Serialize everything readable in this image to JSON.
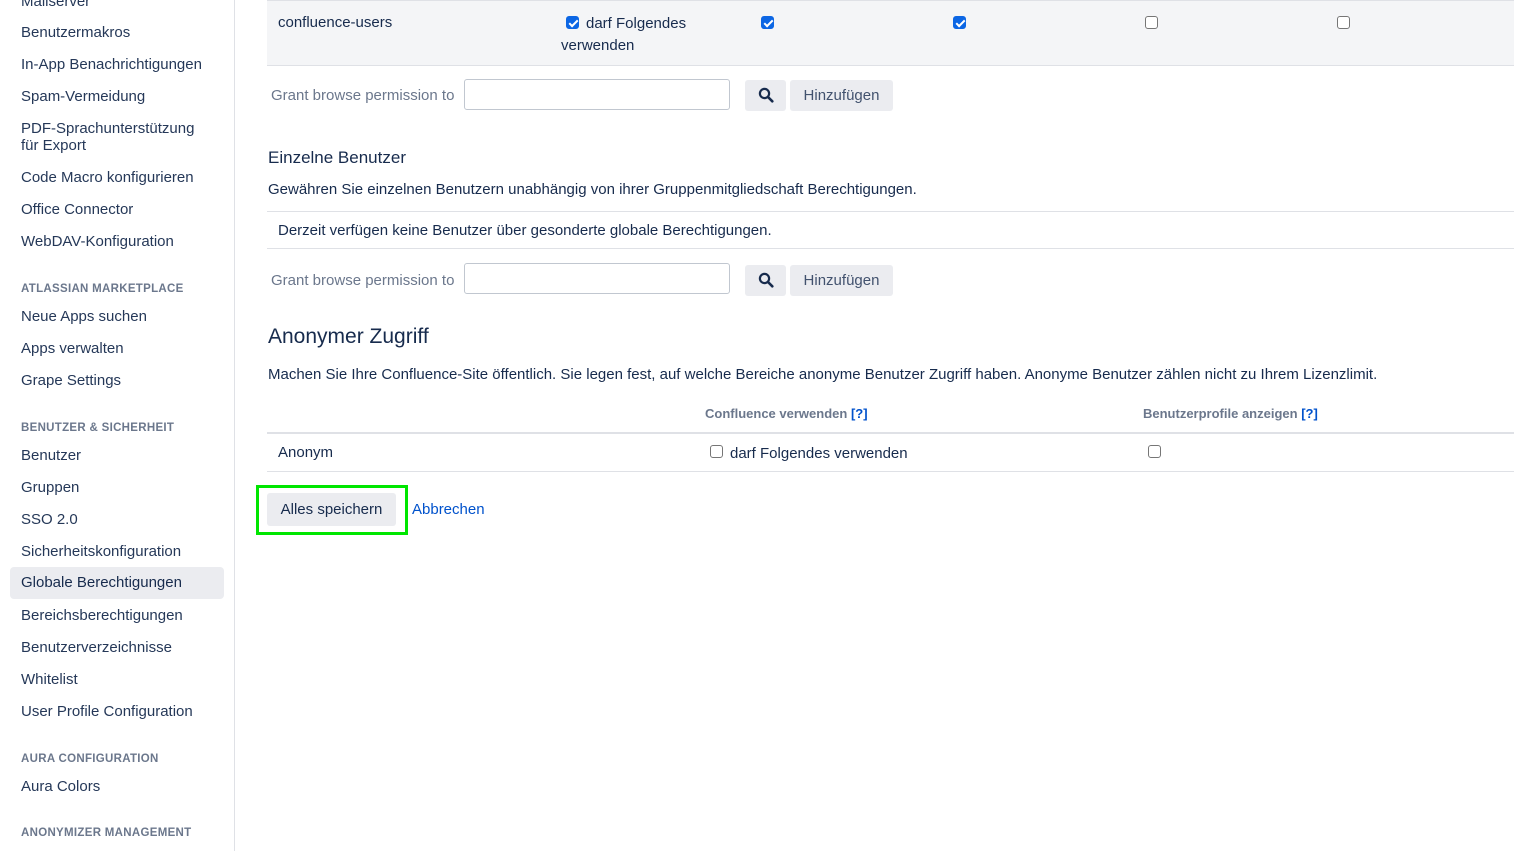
{
  "sidebar": {
    "items_top": [
      {
        "label": "Mailserver"
      },
      {
        "label": "Benutzermakros"
      },
      {
        "label": "In-App Benachrichtigungen"
      },
      {
        "label": "Spam-Vermeidung"
      },
      {
        "label": "PDF-Sprachunterstützung für Export"
      },
      {
        "label": "Code Macro konfigurieren"
      },
      {
        "label": "Office Connector"
      },
      {
        "label": "WebDAV-Konfiguration"
      }
    ],
    "marketplace": {
      "heading": "ATLASSIAN MARKETPLACE",
      "items": [
        {
          "label": "Neue Apps suchen"
        },
        {
          "label": "Apps verwalten"
        },
        {
          "label": "Grape Settings"
        }
      ]
    },
    "security": {
      "heading": "BENUTZER & SICHERHEIT",
      "items": [
        {
          "label": "Benutzer"
        },
        {
          "label": "Gruppen"
        },
        {
          "label": "SSO 2.0"
        },
        {
          "label": "Sicherheitskonfiguration"
        },
        {
          "label": "Globale Berechtigungen",
          "active": true
        },
        {
          "label": "Bereichsberechtigungen"
        },
        {
          "label": "Benutzerverzeichnisse"
        },
        {
          "label": "Whitelist"
        },
        {
          "label": "User Profile Configuration"
        }
      ]
    },
    "aura": {
      "heading": "AURA CONFIGURATION",
      "items": [
        {
          "label": "Aura Colors"
        }
      ]
    },
    "anonymizer": {
      "heading": "ANONYMIZER MANAGEMENT"
    }
  },
  "groups_table": {
    "row": {
      "name": "confluence-users",
      "use_label_1": "darf Folgendes",
      "use_label_2": "verwenden",
      "checkboxes": [
        true,
        true,
        true,
        false,
        false
      ]
    },
    "grant_label": "Grant browse permission to",
    "grant_value": "",
    "add_label": "Hinzufügen"
  },
  "individual_users": {
    "title": "Einzelne Benutzer",
    "description": "Gewähren Sie einzelnen Benutzern unabhängig von ihrer Gruppenmitgliedschaft Berechtigungen.",
    "empty_text": "Derzeit verfügen keine Benutzer über gesonderte globale Berechtigungen.",
    "grant_label": "Grant browse permission to",
    "grant_value": "",
    "add_label": "Hinzufügen"
  },
  "anonymous": {
    "title": "Anonymer Zugriff",
    "description": "Machen Sie Ihre Confluence-Site öffentlich. Sie legen fest, auf welche Bereiche anonyme Benutzer Zugriff haben. Anonyme Benutzer zählen nicht zu Ihrem Lizenzlimit.",
    "col_use": "Confluence verwenden",
    "col_profiles": "Benutzerprofile anzeigen",
    "help": "[?]",
    "row_name": "Anonym",
    "use_label": "darf Folgendes verwenden",
    "use_checked": false,
    "profiles_checked": false
  },
  "actions": {
    "save_label": "Alles speichern",
    "cancel_label": "Abbrechen",
    "highlight_color": "#00e600"
  },
  "colors": {
    "accent": "#0052cc",
    "checkbox_checked": "#0c66e4",
    "active_bg": "#ebecf0"
  }
}
